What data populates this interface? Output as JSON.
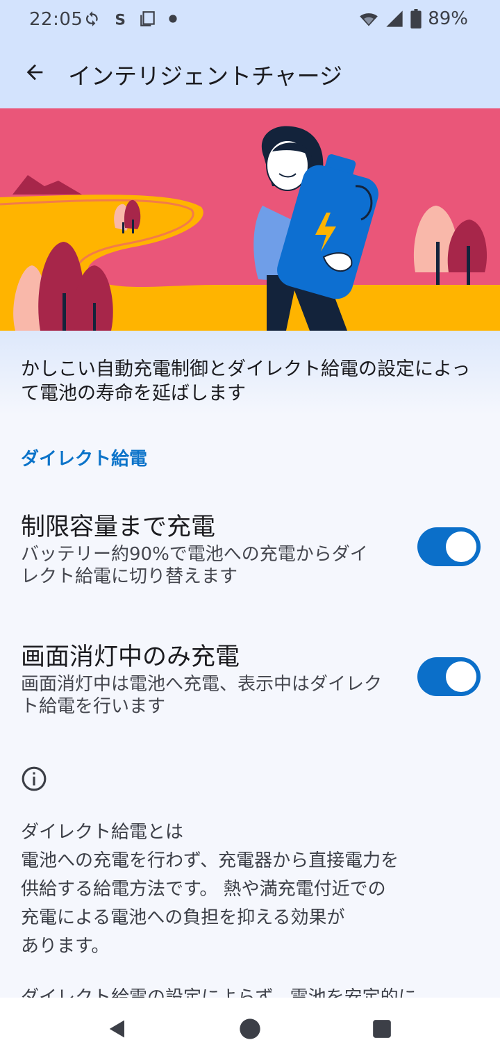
{
  "status_bar": {
    "time": "22:05",
    "battery_percent": "89%",
    "icons": [
      "sync-icon",
      "s-app-icon",
      "screenshot-icon",
      "dot-icon",
      "wifi-icon",
      "signal-icon",
      "battery-icon"
    ]
  },
  "app_bar": {
    "title": "インテリジェントチャージ",
    "back_icon": "arrow-back-icon"
  },
  "hero": {
    "colors": {
      "sky": "#ea5679",
      "road": "#ffb400",
      "tree_dark": "#a7264a",
      "tree_light": "#f9b8aa",
      "battery": "#0d6fd1"
    }
  },
  "description": "かしこい自動充電制御とダイレクト給電の設定によって電池の寿命を延ばします",
  "section": {
    "header": "ダイレクト給電"
  },
  "settings": [
    {
      "title": "制限容量まで充電",
      "summary": "バッテリー約90%で電池への充電からダイレクト給電に切り替えます",
      "enabled": true
    },
    {
      "title": "画面消灯中のみ充電",
      "summary": "画面消灯中は電池へ充電、表示中はダイレクト給電を行います",
      "enabled": true
    }
  ],
  "info": {
    "icon": "info-icon",
    "lines": [
      "ダイレクト給電とは",
      "電池への充電を行わず、充電器から直接電力を",
      "供給する給電方法です。 熱や満充電付近での",
      "充電による電池への負担を抑える効果が",
      "あります。"
    ],
    "cut_line": "ダイレクト給電の設定によらず、電池を安定的に"
  },
  "nav_bar": {
    "buttons": [
      "back-triangle-icon",
      "home-circle-icon",
      "recents-square-icon"
    ]
  },
  "colors": {
    "accent": "#0b6fc9",
    "app_bar_bg": "#d3e3fd",
    "page_bg": "#f5f7fd"
  }
}
